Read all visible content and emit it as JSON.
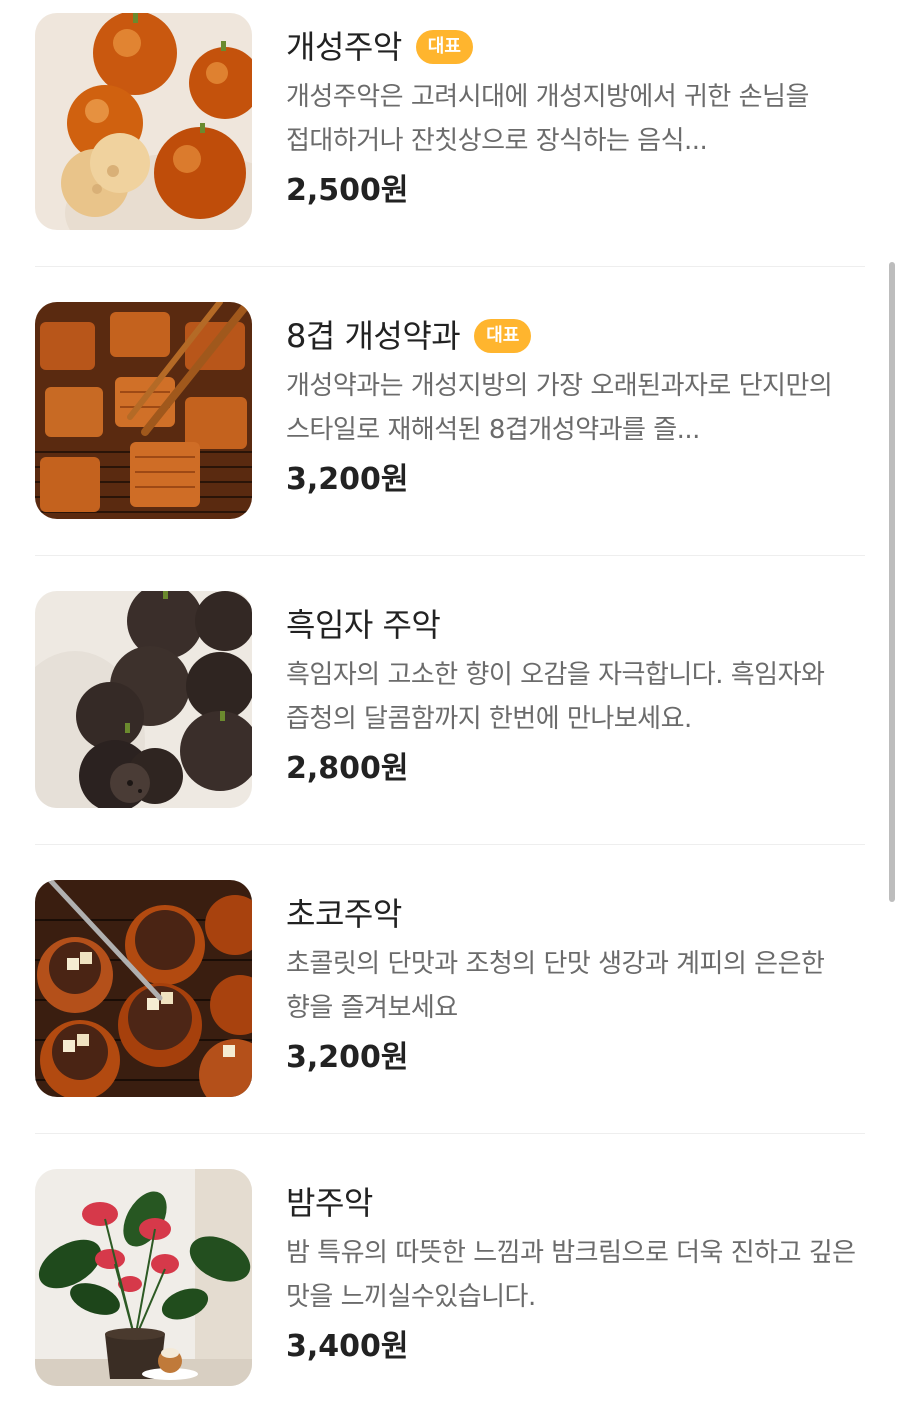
{
  "menu": {
    "items": [
      {
        "name": "개성주악",
        "badge": "대표",
        "description": "개성주악은 고려시대에 개성지방에서 귀한 손님을 접대하거나 잔칫상으로 장식하는 음식...",
        "price": "2,500원",
        "image_icon": "glazed-donut-photo"
      },
      {
        "name": "8겹 개성약과",
        "badge": "대표",
        "description": "개성약과는 개성지방의 가장 오래된과자로 단지만의 스타일로 재해석된 8겹개성약과를 즐...",
        "price": "3,200원",
        "image_icon": "yakgwa-photo"
      },
      {
        "name": "흑임자 주악",
        "badge": "",
        "description": "흑임자의 고소한 향이 오감을 자극합니다. 흑임자와 즙청의 달콤함까지 한번에 만나보세요.",
        "price": "2,800원",
        "image_icon": "black-sesame-donut-photo"
      },
      {
        "name": "초코주악",
        "badge": "",
        "description": "초콜릿의 단맛과 조청의 단맛 생강과 계피의 은은한 향을 즐겨보세요",
        "price": "3,200원",
        "image_icon": "chocolate-donut-photo"
      },
      {
        "name": "밤주악",
        "badge": "",
        "description": "밤 특유의 따뜻한 느낌과 밤크림으로 더욱 진하고 깊은 맛을 느끼실수있습니다.",
        "price": "3,400원",
        "image_icon": "chestnut-donut-flower-photo"
      }
    ]
  },
  "colors": {
    "badge": "#ffb52e",
    "title": "#222222",
    "description": "#6b6b6b",
    "divider": "#eeeeee"
  }
}
